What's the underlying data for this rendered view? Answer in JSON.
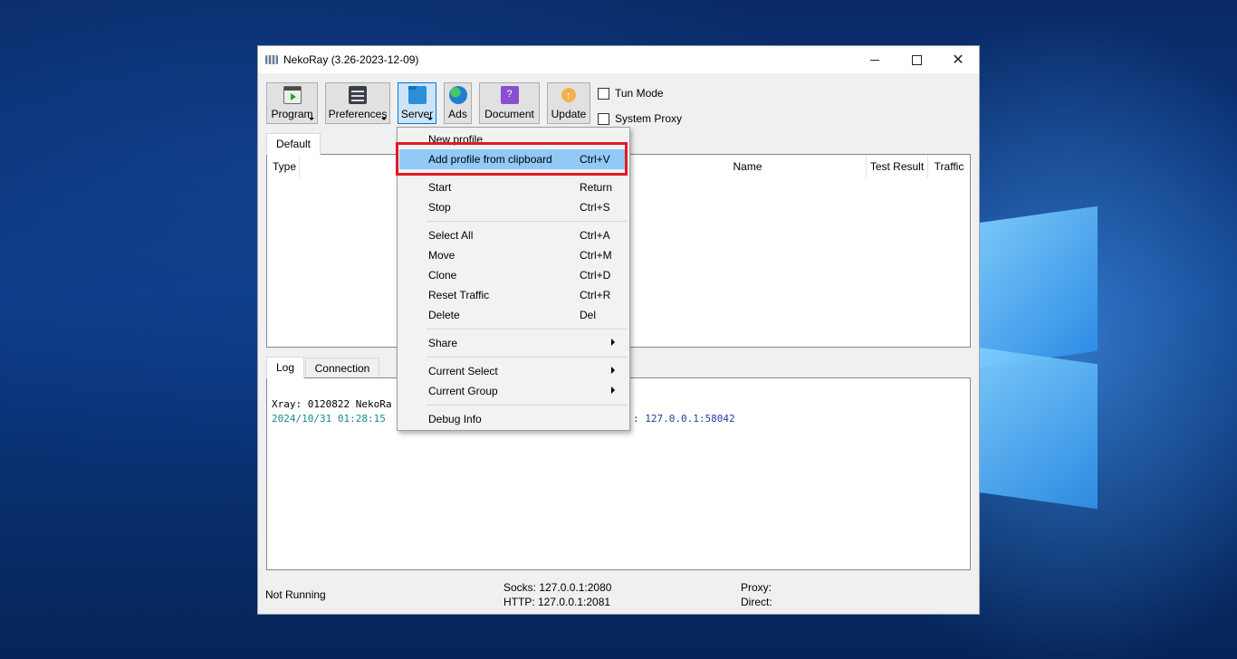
{
  "window": {
    "title": "NekoRay (3.26-2023-12-09)"
  },
  "toolbar": {
    "buttons": [
      {
        "label": "Program"
      },
      {
        "label": "Preferences"
      },
      {
        "label": "Server"
      },
      {
        "label": "Ads"
      },
      {
        "label": "Document"
      },
      {
        "label": "Update"
      }
    ],
    "tun_mode": "Tun Mode",
    "system_proxy": "System Proxy"
  },
  "groups": {
    "tabs": [
      "Default"
    ]
  },
  "table": {
    "columns": [
      "Type",
      "Name",
      "Test Result",
      "Traffic"
    ]
  },
  "log": {
    "tabs": [
      "Log",
      "Connection"
    ],
    "lines": [
      {
        "text": "Xray: 0120822 NekoRa",
        "color": "#000000"
      },
      {
        "text": "2024/10/31 01:28:15",
        "color": "#1a8a8a"
      },
      {
        "text": ": 127.0.0.1:58042",
        "color": "#1f3f9f"
      }
    ]
  },
  "statusbar": {
    "state": "Not Running",
    "socks": "Socks: 127.0.0.1:2080",
    "http": "HTTP: 127.0.0.1:2081",
    "proxy": "Proxy:",
    "direct": "Direct:"
  },
  "menu": {
    "items": [
      {
        "label": "New profile",
        "shortcut": ""
      },
      {
        "label": "Add profile from clipboard",
        "shortcut": "Ctrl+V"
      },
      {
        "label": "Start",
        "shortcut": "Return"
      },
      {
        "label": "Stop",
        "shortcut": "Ctrl+S"
      },
      {
        "label": "Select All",
        "shortcut": "Ctrl+A"
      },
      {
        "label": "Move",
        "shortcut": "Ctrl+M"
      },
      {
        "label": "Clone",
        "shortcut": "Ctrl+D"
      },
      {
        "label": "Reset Traffic",
        "shortcut": "Ctrl+R"
      },
      {
        "label": "Delete",
        "shortcut": "Del"
      },
      {
        "label": "Share",
        "shortcut": ""
      },
      {
        "label": "Current Select",
        "shortcut": ""
      },
      {
        "label": "Current Group",
        "shortcut": ""
      },
      {
        "label": "Debug Info",
        "shortcut": ""
      }
    ]
  },
  "colors": {
    "highlight": "#91c9f7",
    "annotation": "#e21b23",
    "active_button": "#cce4f7"
  }
}
